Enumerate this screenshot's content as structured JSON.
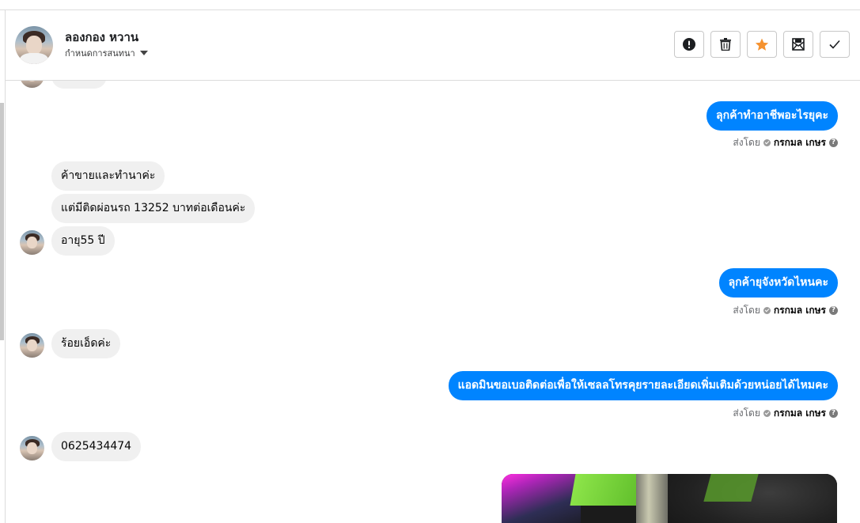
{
  "header": {
    "contact_name": "ลองกอง หวาน",
    "conversation_setting_label": "กำหนดการสนทนา",
    "actions": [
      {
        "name": "report-button",
        "icon": "exclamation-circle-icon"
      },
      {
        "name": "delete-button",
        "icon": "trash-icon"
      },
      {
        "name": "star-button",
        "icon": "star-icon"
      },
      {
        "name": "mark-unread-button",
        "icon": "envelope-icon"
      },
      {
        "name": "done-button",
        "icon": "checkmark-icon"
      }
    ],
    "star_color": "#f5922f"
  },
  "messages": [
    {
      "direction": "out",
      "text": "ลุกค้าทำอาชีพอะไรยุคะ"
    },
    {
      "direction": "in",
      "text": "ค้าขายและทำนาค่ะ"
    },
    {
      "direction": "in",
      "text": "แต่มีติดผ่อนรถ 13252 บาทต่อเดือนค่ะ"
    },
    {
      "direction": "in",
      "text": "อายุ55 ปี"
    },
    {
      "direction": "out",
      "text": "ลุกค้ายุจังหวัดไหนคะ"
    },
    {
      "direction": "in",
      "text": "ร้อยเอ็ดค่ะ"
    },
    {
      "direction": "out",
      "text": "แอดมินขอเบอติดต่อเพื่อให้เซลลโทรคุยรายละเอียดเพิ่มเติมด้วยหน่อยได้ไหมคะ"
    },
    {
      "direction": "in",
      "text": "0625434474"
    }
  ],
  "sent_by": {
    "prefix": "ส่งโดย",
    "agent": "กรกมล เกษร",
    "help": "?"
  },
  "colors": {
    "outgoing_bubble": "#0084ff",
    "incoming_bubble": "#f0f0f0"
  }
}
